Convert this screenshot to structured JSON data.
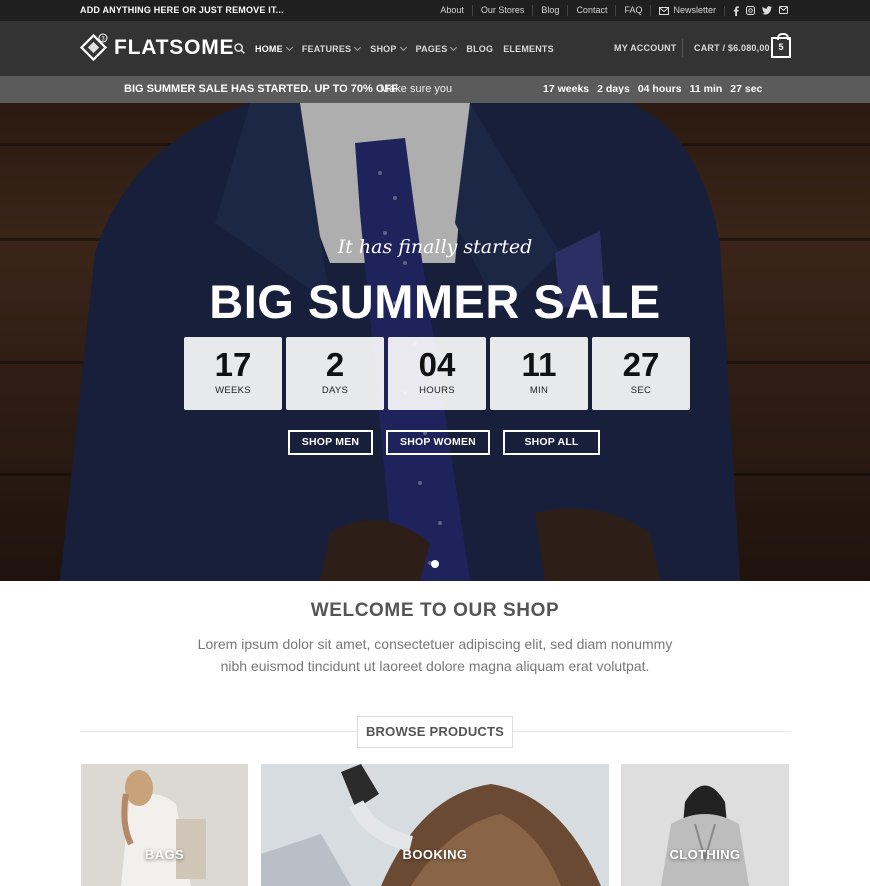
{
  "topbar": {
    "promo": "ADD ANYTHING HERE OR JUST REMOVE IT...",
    "links": [
      "About",
      "Our Stores",
      "Blog",
      "Contact",
      "FAQ"
    ],
    "newsletter": "Newsletter",
    "social_icons": [
      "facebook-icon",
      "instagram-icon",
      "twitter-icon",
      "mail-icon"
    ]
  },
  "header": {
    "logo_text": "FLATSOME",
    "logo_badge": "3",
    "nav": [
      {
        "label": "HOME",
        "dropdown": true
      },
      {
        "label": "FEATURES",
        "dropdown": true
      },
      {
        "label": "SHOP",
        "dropdown": true
      },
      {
        "label": "PAGES",
        "dropdown": true
      },
      {
        "label": "BLOG",
        "dropdown": false
      },
      {
        "label": "ELEMENTS",
        "dropdown": false
      }
    ],
    "account": "MY ACCOUNT",
    "cart_label": "CART / $6.080,00",
    "cart_count": "5"
  },
  "salebar": {
    "headline": "BIG SUMMER SALE HAS STARTED. UP TO 70% OFF",
    "more": "Make sure you",
    "countdown": [
      "17 weeks",
      "2 days",
      "04 hours",
      "11 min",
      "27 sec"
    ]
  },
  "hero": {
    "script": "It has finally started",
    "title": "BIG SUMMER SALE",
    "countdown": [
      {
        "value": "17",
        "unit": "WEEKS"
      },
      {
        "value": "2",
        "unit": "DAYS"
      },
      {
        "value": "04",
        "unit": "HOURS"
      },
      {
        "value": "11",
        "unit": "MIN"
      },
      {
        "value": "27",
        "unit": "SEC"
      }
    ],
    "buttons": [
      "SHOP MEN",
      "SHOP WOMEN",
      "SHOP ALL"
    ]
  },
  "welcome": {
    "title": "WELCOME TO OUR SHOP",
    "text": "Lorem ipsum dolor sit amet, consectetuer adipiscing elit, sed diam nonummy nibh euismod tincidunt ut laoreet dolore magna aliquam erat volutpat."
  },
  "browse": {
    "title": "BROWSE PRODUCTS",
    "categories": [
      "BAGS",
      "BOOKING",
      "CLOTHING"
    ]
  },
  "colors": {
    "topbar_bg": "#1f1f1f",
    "header_bg": "#333333",
    "salebar_bg": "#5b5b5b",
    "text_muted": "#777777"
  }
}
